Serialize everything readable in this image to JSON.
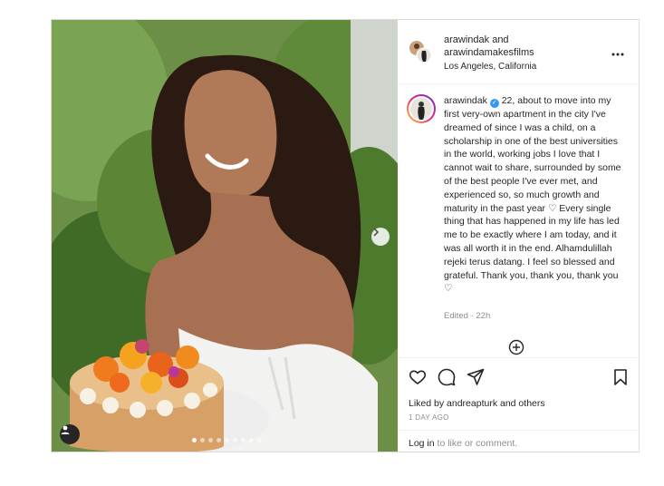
{
  "post": {
    "header": {
      "names_line1": "arawindak and",
      "names_line2": "arawindamakesfilms",
      "location": "Los Angeles, California",
      "more_icon": "more-horizontal-icon"
    },
    "media": {
      "description_icon": "photo",
      "carousel_total": 9,
      "carousel_active": 1
    },
    "caption": {
      "username": "arawindak",
      "text": "22, about to move into my first very-own apartment in the city I've dreamed of since I was a child, on a scholarship in one of the best universities in the world, working jobs I love that I cannot wait to share, surrounded by some of the best people I've ever met, and experienced so, so much growth and maturity in the past year ♡ Every single thing that has happened in my life has led me to be exactly where I am today, and it was all worth it in the end. Alhamdulillah rejeki terus datang. I feel so blessed and grateful. Thank you, thank you, thank you ♡",
      "edited": "Edited · 22h"
    },
    "likes_prefix": "Liked by ",
    "likes_user": "andreapturk",
    "likes_suffix": " and others",
    "date": "1 DAY AGO",
    "login_link": "Log in",
    "login_text": " to like or comment."
  }
}
